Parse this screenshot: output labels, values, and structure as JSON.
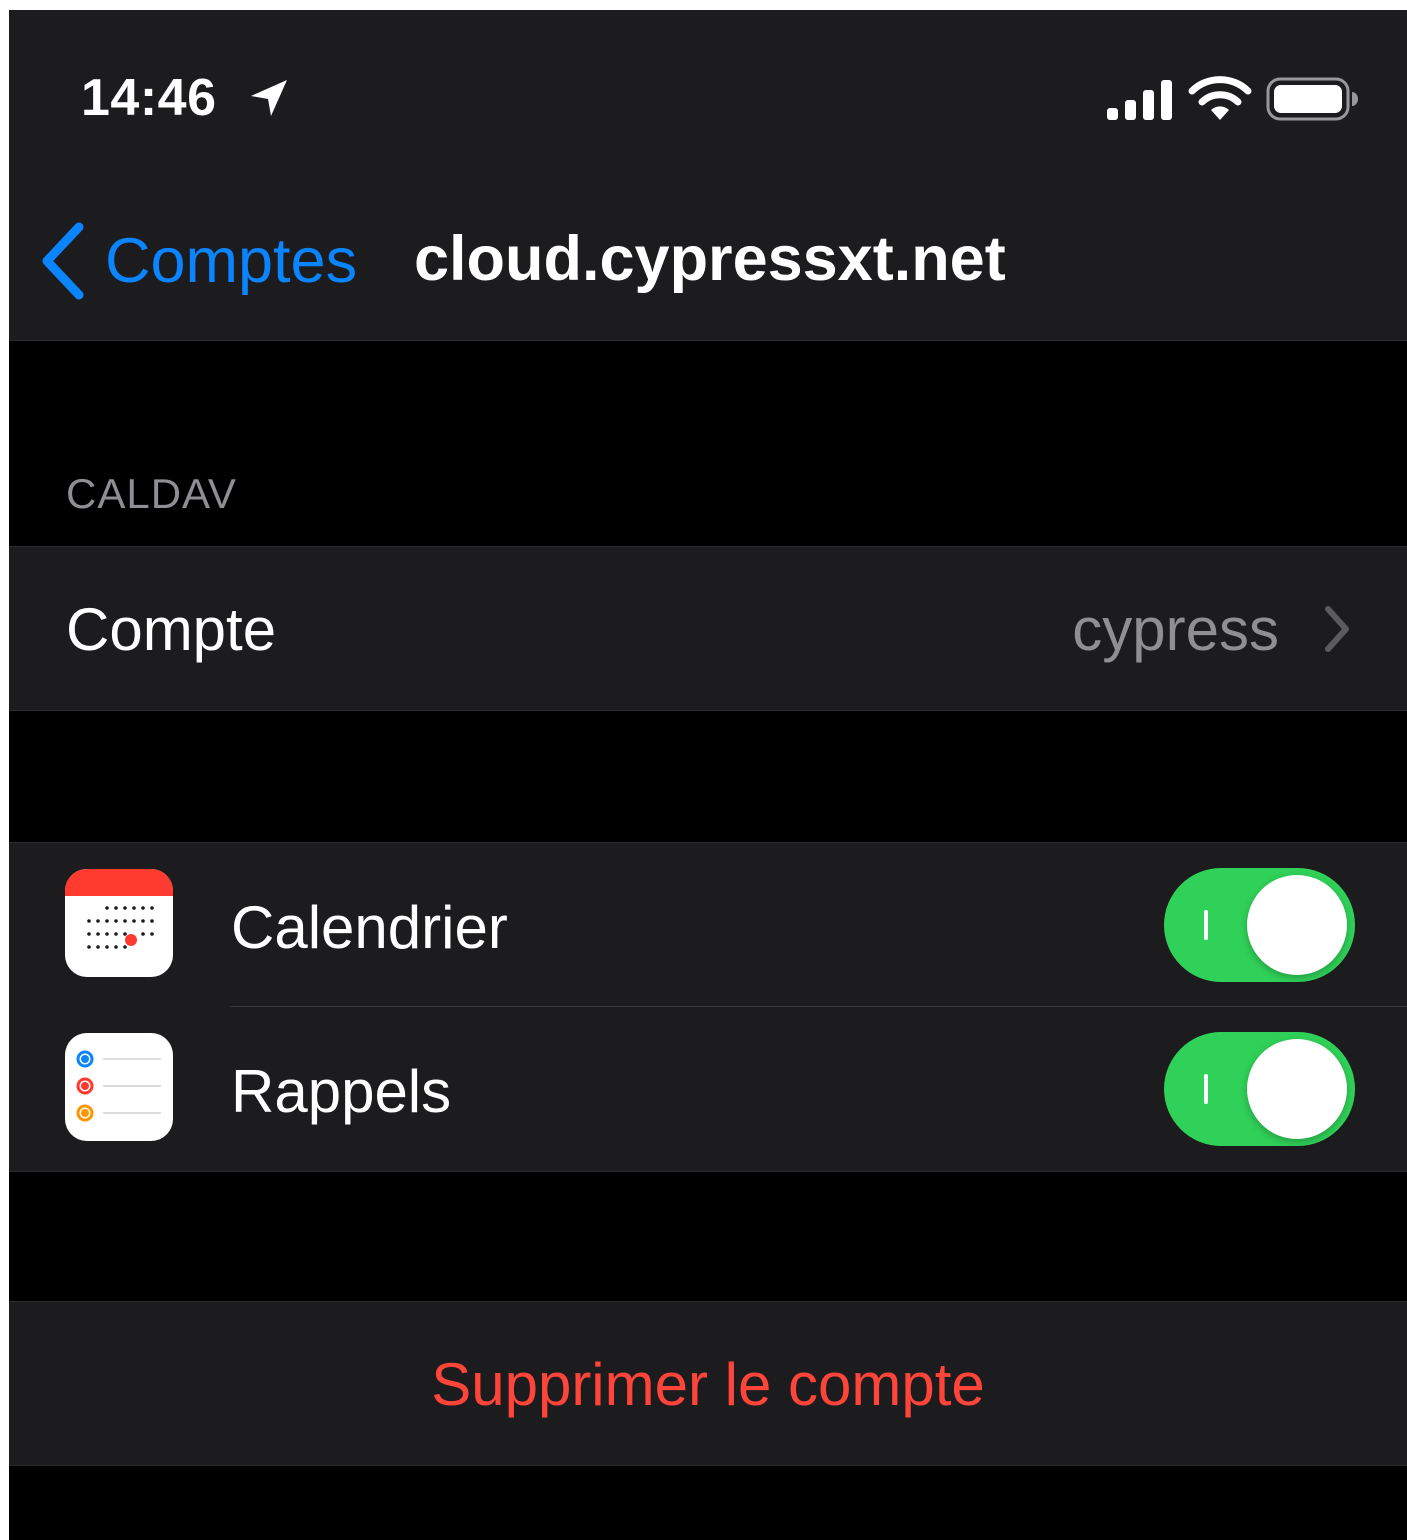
{
  "status_bar": {
    "time": "14:46",
    "location_icon": "location-arrow",
    "signal_icon": "cellular-signal",
    "wifi_icon": "wifi",
    "battery_icon": "battery-full"
  },
  "nav": {
    "back_label": "Comptes",
    "title": "cloud.cypressxt.net"
  },
  "section_header": "CALDAV",
  "account_row": {
    "label": "Compte",
    "value": "cypress"
  },
  "apps": [
    {
      "label": "Calendrier",
      "icon": "calendar-app-icon",
      "enabled": true
    },
    {
      "label": "Rappels",
      "icon": "reminders-app-icon",
      "enabled": true
    }
  ],
  "delete_label": "Supprimer le compte",
  "colors": {
    "accent": "#0a84ff",
    "toggle_on": "#30d158",
    "destructive": "#ff453a",
    "secondary_text": "#8e8e93"
  }
}
